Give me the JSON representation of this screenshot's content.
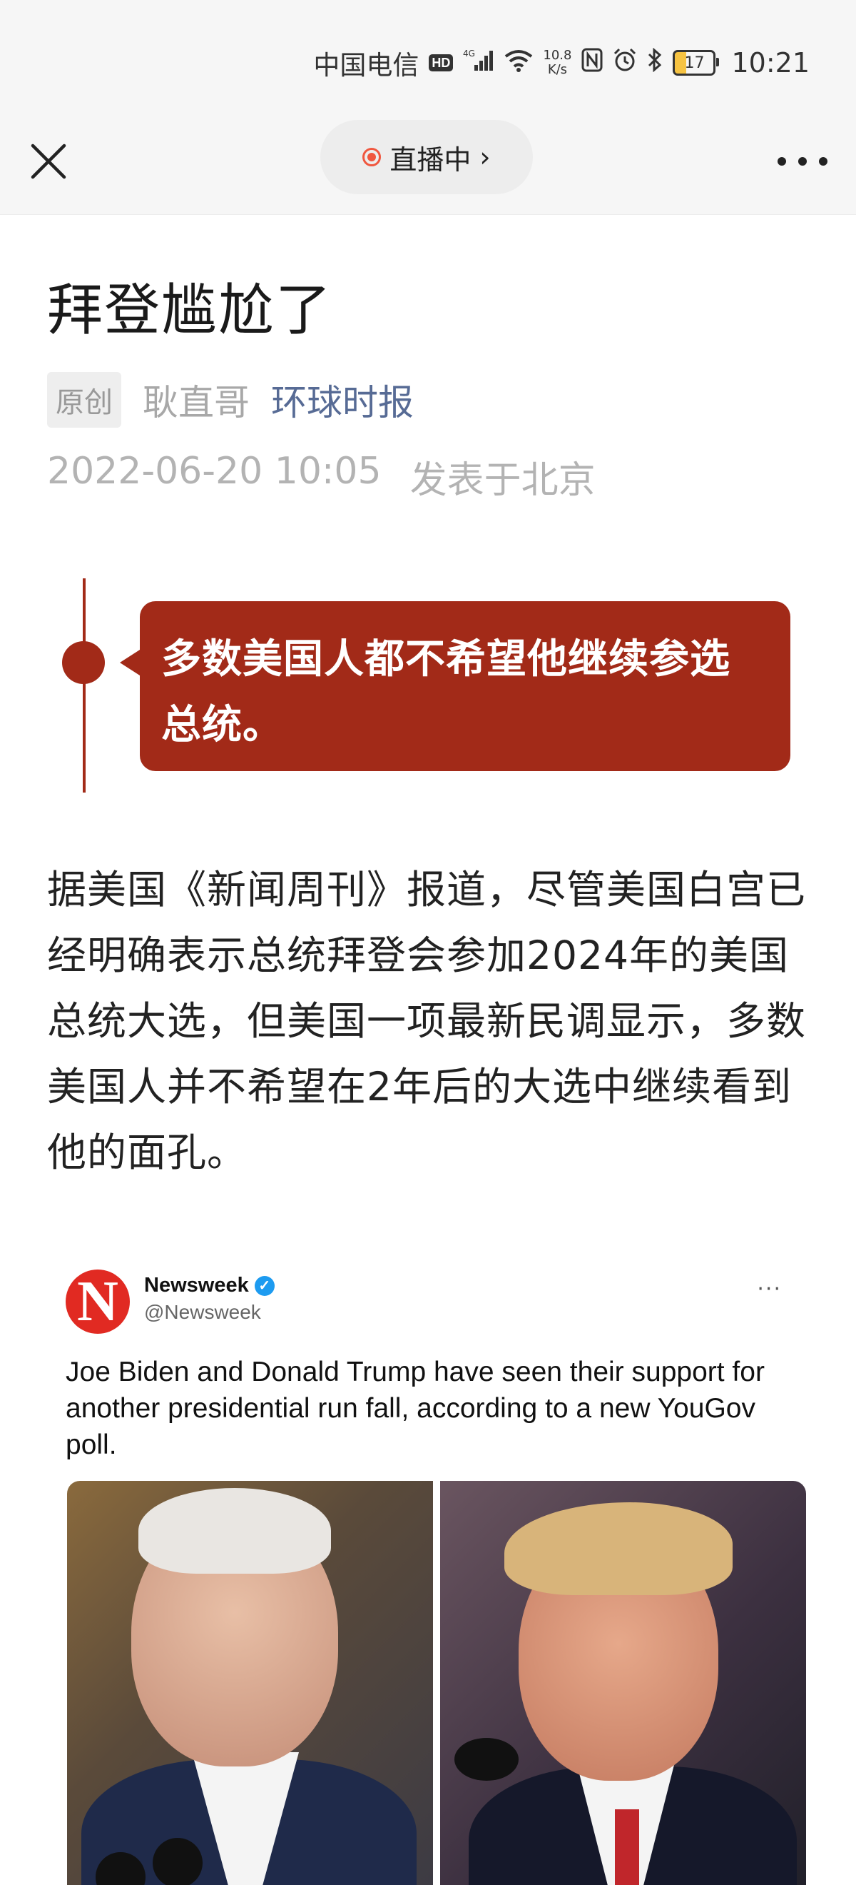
{
  "status_bar": {
    "carrier": "中国电信",
    "hd": "HD",
    "signal": "4G",
    "net_speed_value": "10.8",
    "net_speed_unit": "K/s",
    "battery": "17",
    "time": "10:21"
  },
  "nav": {
    "live_label": "直播中",
    "live_chevron": "›"
  },
  "article": {
    "title": "拜登尴尬了",
    "original_badge": "原创",
    "author": "耿直哥",
    "account": "环球时报",
    "date": "2022-06-20 10:05",
    "location": "发表于北京",
    "callout": "多数美国人都不希望他继续参选总统。",
    "body": "据美国《新闻周刊》报道，尽管美国白宫已经明确表示总统拜登会参加2024年的美国总统大选，但美国一项最新民调显示，多数美国人并不希望在2年后的大选中继续看到他的面孔。"
  },
  "tweet": {
    "logo_letter": "N",
    "name": "Newsweek",
    "handle": "@Newsweek",
    "more": "···",
    "text": "Joe Biden and Donald Trump have seen their support for another presidential run fall, according to a new YouGov poll."
  },
  "colors": {
    "accent_red": "#a22a18",
    "link_blue": "#576b95",
    "live_dot": "#f0573f"
  },
  "icons": {
    "close": "close-icon",
    "more": "more-dots-icon",
    "verified": "verified-badge-icon"
  }
}
